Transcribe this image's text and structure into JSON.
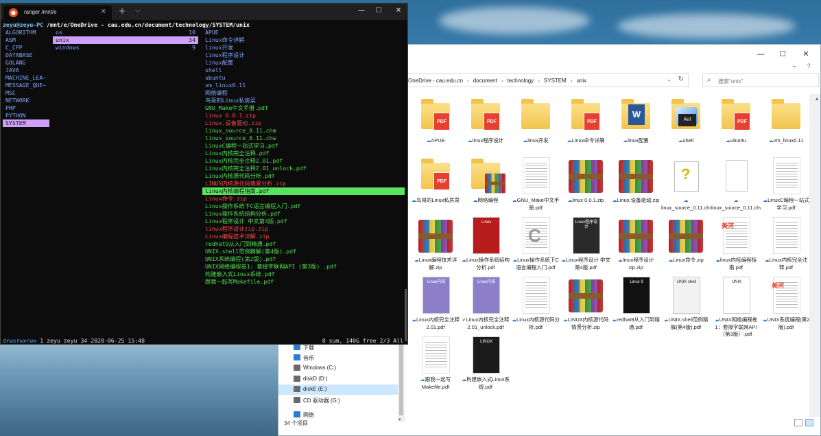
{
  "terminal": {
    "tab_title": "ranger /mnt/e",
    "tab_close": "×",
    "new_tab": "+",
    "tab_dropdown": "⌵",
    "controls": {
      "minimize": "—",
      "maximize": "☐",
      "close": "✕"
    },
    "path_user": "zeyu@zeyu-PC",
    "path_dir": " /mnt/e/OneDrive - cau.edu.cn/document/technology/SYSTEM/unix",
    "parent_column": [
      "ALGORITHM",
      "ASM",
      "C_CPP",
      "DATABASE",
      "GOLANG",
      "JAVA",
      "MACHINE_LEA~",
      "MESSAGE_QUE~",
      "MSC",
      "NETWORK",
      "PHP",
      "PYTHON",
      "SYSTEM"
    ],
    "parent_selected_index": 12,
    "current_column": [
      {
        "name": "os",
        "count": "10"
      },
      {
        "name": "unix",
        "count": "34"
      },
      {
        "name": "windows",
        "count": "9"
      }
    ],
    "current_selected_index": 1,
    "preview_column": [
      {
        "name": "APUE",
        "color": "dir"
      },
      {
        "name": "Linux命令详解",
        "color": "dir"
      },
      {
        "name": "linux开发",
        "color": "dir"
      },
      {
        "name": "linux程序设计",
        "color": "dir"
      },
      {
        "name": "linux配置",
        "color": "dir"
      },
      {
        "name": "shell",
        "color": "dir"
      },
      {
        "name": "ubuntu",
        "color": "dir"
      },
      {
        "name": "vm_linux0.11",
        "color": "dir"
      },
      {
        "name": "网络编程",
        "color": "dir"
      },
      {
        "name": "鸟哥的Linux私房菜",
        "color": "dir"
      },
      {
        "name": "GNU_Make中文手册.pdf",
        "color": "green"
      },
      {
        "name": "linux 0.0.1.zip",
        "color": "red"
      },
      {
        "name": "Linux.设备驱动.zip",
        "color": "red"
      },
      {
        "name": "linux_source_0.11.chm",
        "color": "green"
      },
      {
        "name": "linux_source_0.11.chw",
        "color": "green"
      },
      {
        "name": "LinuxC编程一站式学习.pdf",
        "color": "green"
      },
      {
        "name": "Linux内核完全注释.pdf",
        "color": "green"
      },
      {
        "name": "Linux内核完全注释2.01.pdf",
        "color": "green"
      },
      {
        "name": "Linux内核完全注释2.01_unlock.pdf",
        "color": "green"
      },
      {
        "name": "Linux内核源代码分析.pdf",
        "color": "green"
      },
      {
        "name": "LINUX内核源代码情景分析.zip",
        "color": "red"
      },
      {
        "name": "linux内核编程指南.pdf",
        "color": "green"
      },
      {
        "name": "Linux命令.zip",
        "color": "red"
      },
      {
        "name": "Linux操作系统下C语言编程入门.pdf",
        "color": "green"
      },
      {
        "name": "Linux操作系统结构分析.pdf",
        "color": "green"
      },
      {
        "name": "Linux程序设计 中文第4版.pdf",
        "color": "green"
      },
      {
        "name": "linux程序设计zip.zip",
        "color": "red"
      },
      {
        "name": "Linux编程技术详解.zip",
        "color": "red"
      },
      {
        "name": "redhat9从入门到精通.pdf",
        "color": "green"
      },
      {
        "name": "UNIX.shell范例精解(第4版).pdf",
        "color": "green"
      },
      {
        "name": "UNIX系统编程(第2版).pdf",
        "color": "green"
      },
      {
        "name": "UNIX网络编程卷1: 套接字联网API (第3版) .pdf",
        "color": "green"
      },
      {
        "name": "构建嵌入式Linux系统.pdf",
        "color": "green"
      },
      {
        "name": "跟我一起写Makefile.pdf",
        "color": "green"
      }
    ],
    "preview_selected_index": 21,
    "status_perm": "drwxrwxrwx",
    "status_info": " 1 zeyu zeyu 34 2020-06-25 15:48",
    "status_right": "0 sum, 140G free  2/3  All"
  },
  "explorer": {
    "controls": {
      "minimize": "—",
      "maximize": "☐",
      "close": "✕"
    },
    "collapse_ribbon": "⌄",
    "help": "?",
    "address": [
      "OneDrive - cau.edu.cn",
      "document",
      "technology",
      "SYSTEM",
      "unix"
    ],
    "address_sep": "›",
    "address_dropdown": "⌄",
    "refresh": "↻",
    "search_icon": "⌕",
    "search_placeholder": "搜索\"unix\"",
    "nav": [
      {
        "label": "下载",
        "color": "#2b7cd3"
      },
      {
        "label": "音乐",
        "color": "#2b7cd3"
      },
      {
        "label": "Windows (C:)",
        "color": "#6a6a6a"
      },
      {
        "label": "diskD (D:)",
        "color": "#6a6a6a"
      },
      {
        "label": "diskE (E:)",
        "color": "#6a6a6a"
      },
      {
        "label": "CD 驱动器 (G:)",
        "color": "#6a6a6a"
      },
      {
        "label": "网络",
        "color": "#2b7cd3"
      }
    ],
    "nav_selected_index": 4,
    "nav_scroll_down": "▾",
    "scroll_up": "▴",
    "status": "34 个项目",
    "sync_icon": "☁",
    "sync_ok_icon": "✔",
    "files": [
      {
        "name": "APUE",
        "type": "folder-pdf",
        "sync": "cloud"
      },
      {
        "name": "linux程序设计",
        "type": "folder-pdf",
        "sync": "cloud"
      },
      {
        "name": "linux开发",
        "type": "folder",
        "sync": "cloud"
      },
      {
        "name": "Linux命令详解",
        "type": "folder-pdf",
        "sync": "cloud"
      },
      {
        "name": "linux配置",
        "type": "folder-doc",
        "sync": "cloud"
      },
      {
        "name": "shell",
        "type": "folder-avi",
        "sync": "cloud"
      },
      {
        "name": "ubuntu",
        "type": "folder-pdf",
        "sync": "cloud"
      },
      {
        "name": "vm_linux0.11",
        "type": "folder",
        "sync": "cloud"
      },
      {
        "name": "鸟哥的Linux私房菜",
        "type": "folder-pdf",
        "sync": "cloud"
      },
      {
        "name": "网络编程",
        "type": "folder-winrar",
        "sync": "cloud"
      },
      {
        "name": "GNU_Make中文手册.pdf",
        "type": "page",
        "sync": "cloud"
      },
      {
        "name": "linux 0.0.1.zip",
        "type": "winrar",
        "sync": "cloud"
      },
      {
        "name": "Linux.设备驱动.zip",
        "type": "winrar",
        "sync": "cloud"
      },
      {
        "name": "linux_source_0.11.chm",
        "type": "chm",
        "sync": "cloud"
      },
      {
        "name": "linux_source_0.11.chw",
        "type": "blank",
        "sync": "cloud"
      },
      {
        "name": "LinuxC编程一站式学习.pdf",
        "type": "page",
        "sync": "cloud"
      },
      {
        "name": "Linux编程技术详解.zip",
        "type": "winrar",
        "sync": "cloud"
      },
      {
        "name": "Linux操作系统结构分析.pdf",
        "type": "cover-linux",
        "sync": "cloud"
      },
      {
        "name": "Linux操作系统下C语言编程入门.pdf",
        "type": "page-c",
        "sync": "cloud"
      },
      {
        "name": "Linux程序设计 中文第4版.pdf",
        "type": "cover-dark",
        "sync": "cloud"
      },
      {
        "name": "linux程序设计zip.zip",
        "type": "winrar",
        "sync": "cloud"
      },
      {
        "name": "Linux命令.zip",
        "type": "winrar",
        "sync": "cloud"
      },
      {
        "name": "linux内核编程指南.pdf",
        "type": "page-logo",
        "sync": "cloud"
      },
      {
        "name": "Linux内核完全注释.pdf",
        "type": "page",
        "sync": "cloud"
      },
      {
        "name": "Linux内核完全注释2.01.pdf",
        "type": "cover-purple",
        "sync": "cloud"
      },
      {
        "name": "Linux内核完全注释2.01_unlock.pdf",
        "type": "cover-purple",
        "sync": "ok"
      },
      {
        "name": "Linux内核源代码分析.pdf",
        "type": "page",
        "sync": "cloud"
      },
      {
        "name": "LINUX内核源代码情景分析.zip",
        "type": "winrar",
        "sync": "cloud"
      },
      {
        "name": "redhat9从入门到精通.pdf",
        "type": "cover-black",
        "sync": "cloud"
      },
      {
        "name": "UNIX.shell范例精解(第4版).pdf",
        "type": "cover-unix",
        "sync": "cloud"
      },
      {
        "name": "UNIX网络编程卷1：套接字联网API（第3版）.pdf",
        "type": "cover-unet",
        "sync": "cloud"
      },
      {
        "name": "UNIX系统编程(第2版).pdf",
        "type": "page-logo",
        "sync": "cloud"
      },
      {
        "name": "跟我一起写Makefile.pdf",
        "type": "page",
        "sync": "cloud"
      },
      {
        "name": "构建嵌入式Linux系统.pdf",
        "type": "cover-embedded",
        "sync": "cloud"
      }
    ],
    "thumb_labels": {
      "pdf": "PDF",
      "doc": "W",
      "avi": "AVI",
      "chm": "?",
      "c": "C",
      "logo": "美河",
      "linux_cover": "Linux",
      "dark_cover": "Linux程序设计",
      "redhat_cover": "Linux 9",
      "unix_cover": "UNIX shell",
      "unet_cover": "UNIX",
      "embedded_cover": "LINUX",
      "purple_cover": "Linux内核"
    },
    "thumb_colors": {
      "folder": "#f3c44c",
      "pdf": "#e8402f",
      "purple": "#8d7fc9",
      "dark": "#2a2a2a",
      "black": "#111111"
    }
  }
}
